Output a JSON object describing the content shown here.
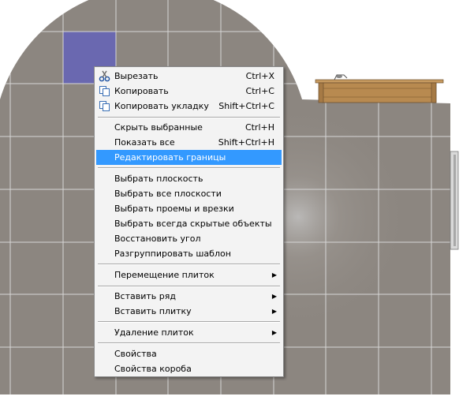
{
  "context_menu": {
    "items": [
      {
        "label": "Вырезать",
        "shortcut": "Ctrl+X",
        "icon": "scissors-icon"
      },
      {
        "label": "Копировать",
        "shortcut": "Ctrl+C",
        "icon": "copy-icon"
      },
      {
        "label": "Копировать укладку",
        "shortcut": "Shift+Ctrl+C",
        "icon": "copy-layout-icon"
      },
      {
        "label": "Скрыть выбранные",
        "shortcut": "Ctrl+H"
      },
      {
        "label": "Показать все",
        "shortcut": "Shift+Ctrl+H"
      },
      {
        "label": "Редактировать границы",
        "shortcut": ""
      },
      {
        "label": "Выбрать плоскость",
        "shortcut": ""
      },
      {
        "label": "Выбрать все плоскости",
        "shortcut": ""
      },
      {
        "label": "Выбрать проемы и врезки",
        "shortcut": ""
      },
      {
        "label": "Выбрать всегда скрытые объекты",
        "shortcut": ""
      },
      {
        "label": "Восстановить угол",
        "shortcut": ""
      },
      {
        "label": "Разгруппировать шаблон",
        "shortcut": ""
      },
      {
        "label": "Перемещение плиток",
        "shortcut": "",
        "submenu": true
      },
      {
        "label": "Вставить ряд",
        "shortcut": "",
        "submenu": true
      },
      {
        "label": "Вставить плитку",
        "shortcut": "",
        "submenu": true
      },
      {
        "label": "Удаление плиток",
        "shortcut": "",
        "submenu": true
      },
      {
        "label": "Свойства",
        "shortcut": ""
      },
      {
        "label": "Свойства короба",
        "shortcut": ""
      }
    ],
    "highlighted_item": "Редактировать границы"
  },
  "colors": {
    "tile": "#8c8680",
    "grout": "#d8d8d8",
    "selected_tile": "#6a68b0",
    "highlight": "#3399ff",
    "shelf": "#b88a50"
  }
}
